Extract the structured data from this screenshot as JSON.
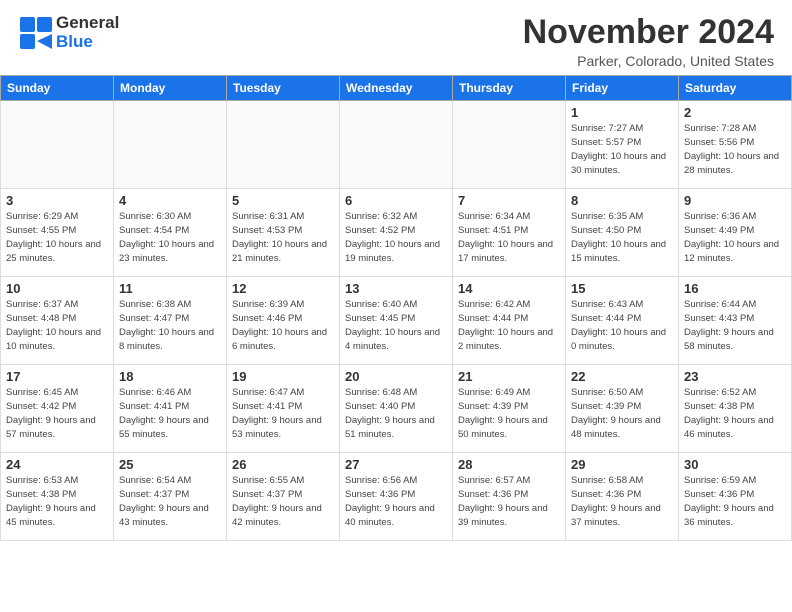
{
  "header": {
    "logo_text_general": "General",
    "logo_text_blue": "Blue",
    "month_title": "November 2024",
    "location": "Parker, Colorado, United States"
  },
  "calendar": {
    "days_of_week": [
      "Sunday",
      "Monday",
      "Tuesday",
      "Wednesday",
      "Thursday",
      "Friday",
      "Saturday"
    ],
    "weeks": [
      [
        {
          "day": "",
          "empty": true
        },
        {
          "day": "",
          "empty": true
        },
        {
          "day": "",
          "empty": true
        },
        {
          "day": "",
          "empty": true
        },
        {
          "day": "",
          "empty": true
        },
        {
          "day": "1",
          "info": "Sunrise: 7:27 AM\nSunset: 5:57 PM\nDaylight: 10 hours and 30 minutes."
        },
        {
          "day": "2",
          "info": "Sunrise: 7:28 AM\nSunset: 5:56 PM\nDaylight: 10 hours and 28 minutes."
        }
      ],
      [
        {
          "day": "3",
          "info": "Sunrise: 6:29 AM\nSunset: 4:55 PM\nDaylight: 10 hours and 25 minutes."
        },
        {
          "day": "4",
          "info": "Sunrise: 6:30 AM\nSunset: 4:54 PM\nDaylight: 10 hours and 23 minutes."
        },
        {
          "day": "5",
          "info": "Sunrise: 6:31 AM\nSunset: 4:53 PM\nDaylight: 10 hours and 21 minutes."
        },
        {
          "day": "6",
          "info": "Sunrise: 6:32 AM\nSunset: 4:52 PM\nDaylight: 10 hours and 19 minutes."
        },
        {
          "day": "7",
          "info": "Sunrise: 6:34 AM\nSunset: 4:51 PM\nDaylight: 10 hours and 17 minutes."
        },
        {
          "day": "8",
          "info": "Sunrise: 6:35 AM\nSunset: 4:50 PM\nDaylight: 10 hours and 15 minutes."
        },
        {
          "day": "9",
          "info": "Sunrise: 6:36 AM\nSunset: 4:49 PM\nDaylight: 10 hours and 12 minutes."
        }
      ],
      [
        {
          "day": "10",
          "info": "Sunrise: 6:37 AM\nSunset: 4:48 PM\nDaylight: 10 hours and 10 minutes."
        },
        {
          "day": "11",
          "info": "Sunrise: 6:38 AM\nSunset: 4:47 PM\nDaylight: 10 hours and 8 minutes."
        },
        {
          "day": "12",
          "info": "Sunrise: 6:39 AM\nSunset: 4:46 PM\nDaylight: 10 hours and 6 minutes."
        },
        {
          "day": "13",
          "info": "Sunrise: 6:40 AM\nSunset: 4:45 PM\nDaylight: 10 hours and 4 minutes."
        },
        {
          "day": "14",
          "info": "Sunrise: 6:42 AM\nSunset: 4:44 PM\nDaylight: 10 hours and 2 minutes."
        },
        {
          "day": "15",
          "info": "Sunrise: 6:43 AM\nSunset: 4:44 PM\nDaylight: 10 hours and 0 minutes."
        },
        {
          "day": "16",
          "info": "Sunrise: 6:44 AM\nSunset: 4:43 PM\nDaylight: 9 hours and 58 minutes."
        }
      ],
      [
        {
          "day": "17",
          "info": "Sunrise: 6:45 AM\nSunset: 4:42 PM\nDaylight: 9 hours and 57 minutes."
        },
        {
          "day": "18",
          "info": "Sunrise: 6:46 AM\nSunset: 4:41 PM\nDaylight: 9 hours and 55 minutes."
        },
        {
          "day": "19",
          "info": "Sunrise: 6:47 AM\nSunset: 4:41 PM\nDaylight: 9 hours and 53 minutes."
        },
        {
          "day": "20",
          "info": "Sunrise: 6:48 AM\nSunset: 4:40 PM\nDaylight: 9 hours and 51 minutes."
        },
        {
          "day": "21",
          "info": "Sunrise: 6:49 AM\nSunset: 4:39 PM\nDaylight: 9 hours and 50 minutes."
        },
        {
          "day": "22",
          "info": "Sunrise: 6:50 AM\nSunset: 4:39 PM\nDaylight: 9 hours and 48 minutes."
        },
        {
          "day": "23",
          "info": "Sunrise: 6:52 AM\nSunset: 4:38 PM\nDaylight: 9 hours and 46 minutes."
        }
      ],
      [
        {
          "day": "24",
          "info": "Sunrise: 6:53 AM\nSunset: 4:38 PM\nDaylight: 9 hours and 45 minutes."
        },
        {
          "day": "25",
          "info": "Sunrise: 6:54 AM\nSunset: 4:37 PM\nDaylight: 9 hours and 43 minutes."
        },
        {
          "day": "26",
          "info": "Sunrise: 6:55 AM\nSunset: 4:37 PM\nDaylight: 9 hours and 42 minutes."
        },
        {
          "day": "27",
          "info": "Sunrise: 6:56 AM\nSunset: 4:36 PM\nDaylight: 9 hours and 40 minutes."
        },
        {
          "day": "28",
          "info": "Sunrise: 6:57 AM\nSunset: 4:36 PM\nDaylight: 9 hours and 39 minutes."
        },
        {
          "day": "29",
          "info": "Sunrise: 6:58 AM\nSunset: 4:36 PM\nDaylight: 9 hours and 37 minutes."
        },
        {
          "day": "30",
          "info": "Sunrise: 6:59 AM\nSunset: 4:36 PM\nDaylight: 9 hours and 36 minutes."
        }
      ]
    ]
  }
}
